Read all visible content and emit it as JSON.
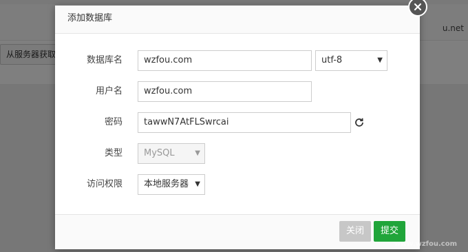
{
  "background": {
    "top_text": "u.net",
    "button_label": "从服务器获取"
  },
  "dialog": {
    "title": "添加数据库",
    "fields": {
      "db_name_label": "数据库名",
      "db_name_value": "wzfou.com",
      "charset_value": "utf-8",
      "username_label": "用户名",
      "username_value": "wzfou.com",
      "password_label": "密码",
      "password_value": "tawwN7AtFLSwrcai",
      "type_label": "类型",
      "type_value": "MySQL",
      "access_label": "访问权限",
      "access_value": "本地服务器"
    },
    "buttons": {
      "close_label": "关闭",
      "submit_label": "提交"
    }
  },
  "watermark": "www.wzfou.com",
  "colors": {
    "submit": "#20a53a",
    "close_button": "#c7c7c7"
  },
  "icons": {
    "close": "close-icon",
    "refresh": "refresh-icon",
    "dropdown": "chevron-down-icon"
  }
}
